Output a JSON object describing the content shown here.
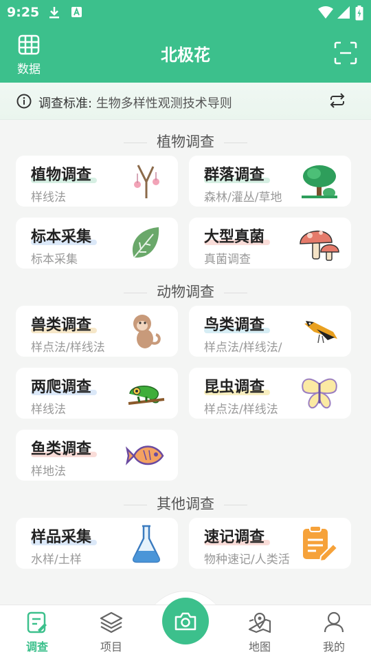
{
  "status": {
    "time": "9:25"
  },
  "header": {
    "title": "北极花",
    "data_label": "数据"
  },
  "notice": {
    "key": "调查标准:",
    "value": "生物多样性观测技术导则"
  },
  "sections": {
    "plant": {
      "title": "植物调查"
    },
    "animal": {
      "title": "动物调查"
    },
    "other": {
      "title": "其他调查"
    }
  },
  "cards": {
    "plant_survey": {
      "title": "植物调查",
      "sub": "样线法",
      "icon": "twig-icon",
      "accent": "#d6efe3"
    },
    "community": {
      "title": "群落调查",
      "sub": "森林/灌丛/草地",
      "icon": "tree-icon",
      "accent": "#d6efe3"
    },
    "specimen": {
      "title": "标本采集",
      "sub": "标本采集",
      "icon": "leaf-icon",
      "accent": "#dbe8f8"
    },
    "fungi": {
      "title": "大型真菌",
      "sub": "真菌调查",
      "icon": "mushroom-icon",
      "accent": "#f9dcd8"
    },
    "mammal": {
      "title": "兽类调查",
      "sub": "样点法/样线法",
      "icon": "monkey-icon",
      "accent": "#f6e7c8"
    },
    "bird": {
      "title": "鸟类调查",
      "sub": "样点法/样线法/",
      "icon": "bird-icon",
      "accent": "#d6edf4"
    },
    "herp": {
      "title": "两爬调查",
      "sub": "样线法",
      "icon": "chameleon-icon",
      "accent": "#dbe8f8"
    },
    "insect": {
      "title": "昆虫调查",
      "sub": "样点法/样线法",
      "icon": "butterfly-icon",
      "accent": "#f8efc0"
    },
    "fish": {
      "title": "鱼类调查",
      "sub": "样地法",
      "icon": "fish-icon",
      "accent": "#f9dcd8"
    },
    "sample": {
      "title": "样品采集",
      "sub": "水样/土样",
      "icon": "flask-icon",
      "accent": "#dbe8f8"
    },
    "quick": {
      "title": "速记调查",
      "sub": "物种速记/人类活",
      "icon": "notepad-icon",
      "accent": "#f9dcd8"
    }
  },
  "nav": {
    "survey": "调查",
    "project": "项目",
    "map": "地图",
    "mine": "我的"
  },
  "colors": {
    "brand": "#3cc08c"
  }
}
